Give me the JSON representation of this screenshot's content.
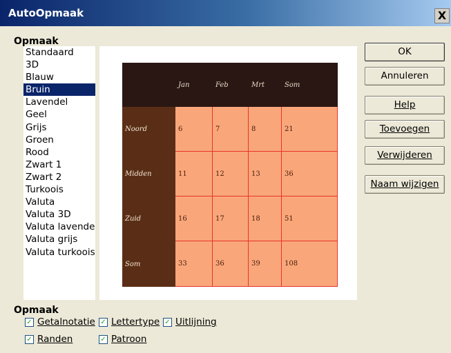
{
  "window": {
    "title": "AutoOpmaak",
    "close_label": "X"
  },
  "format_group": {
    "label": "Opmaak",
    "items": [
      "Standaard",
      "3D",
      "Blauw",
      "Bruin",
      "Lavendel",
      "Geel",
      "Grijs",
      "Groen",
      "Rood",
      "Zwart 1",
      "Zwart 2",
      "Turkoois",
      "Valuta",
      "Valuta 3D",
      "Valuta lavendel",
      "Valuta grijs",
      "Valuta turkoois"
    ],
    "selected": "Bruin"
  },
  "preview": {
    "headers": [
      "",
      "Jan",
      "Feb",
      "Mrt",
      "Som"
    ],
    "rows": [
      {
        "label": "Noord",
        "values": [
          "6",
          "7",
          "8",
          "21"
        ]
      },
      {
        "label": "Midden",
        "values": [
          "11",
          "12",
          "13",
          "36"
        ]
      },
      {
        "label": "Zuid",
        "values": [
          "16",
          "17",
          "18",
          "51"
        ]
      },
      {
        "label": "Som",
        "values": [
          "33",
          "36",
          "39",
          "108"
        ]
      }
    ],
    "colors": {
      "header_bg": "#2a1714",
      "row_header_bg": "#5a2e16",
      "cell_bg": "#f9a77a",
      "grid": "#e8322a"
    }
  },
  "buttons": {
    "ok": "OK",
    "cancel": "Annuleren",
    "help": "Help",
    "add": "Toevoegen",
    "delete": "Verwijderen",
    "rename": "Naam wijzigen"
  },
  "options_group": {
    "label": "Opmaak",
    "number_format": "Getalnotatie",
    "font": "Lettertype",
    "alignment": "Uitlijning",
    "borders": "Randen",
    "pattern": "Patroon"
  }
}
